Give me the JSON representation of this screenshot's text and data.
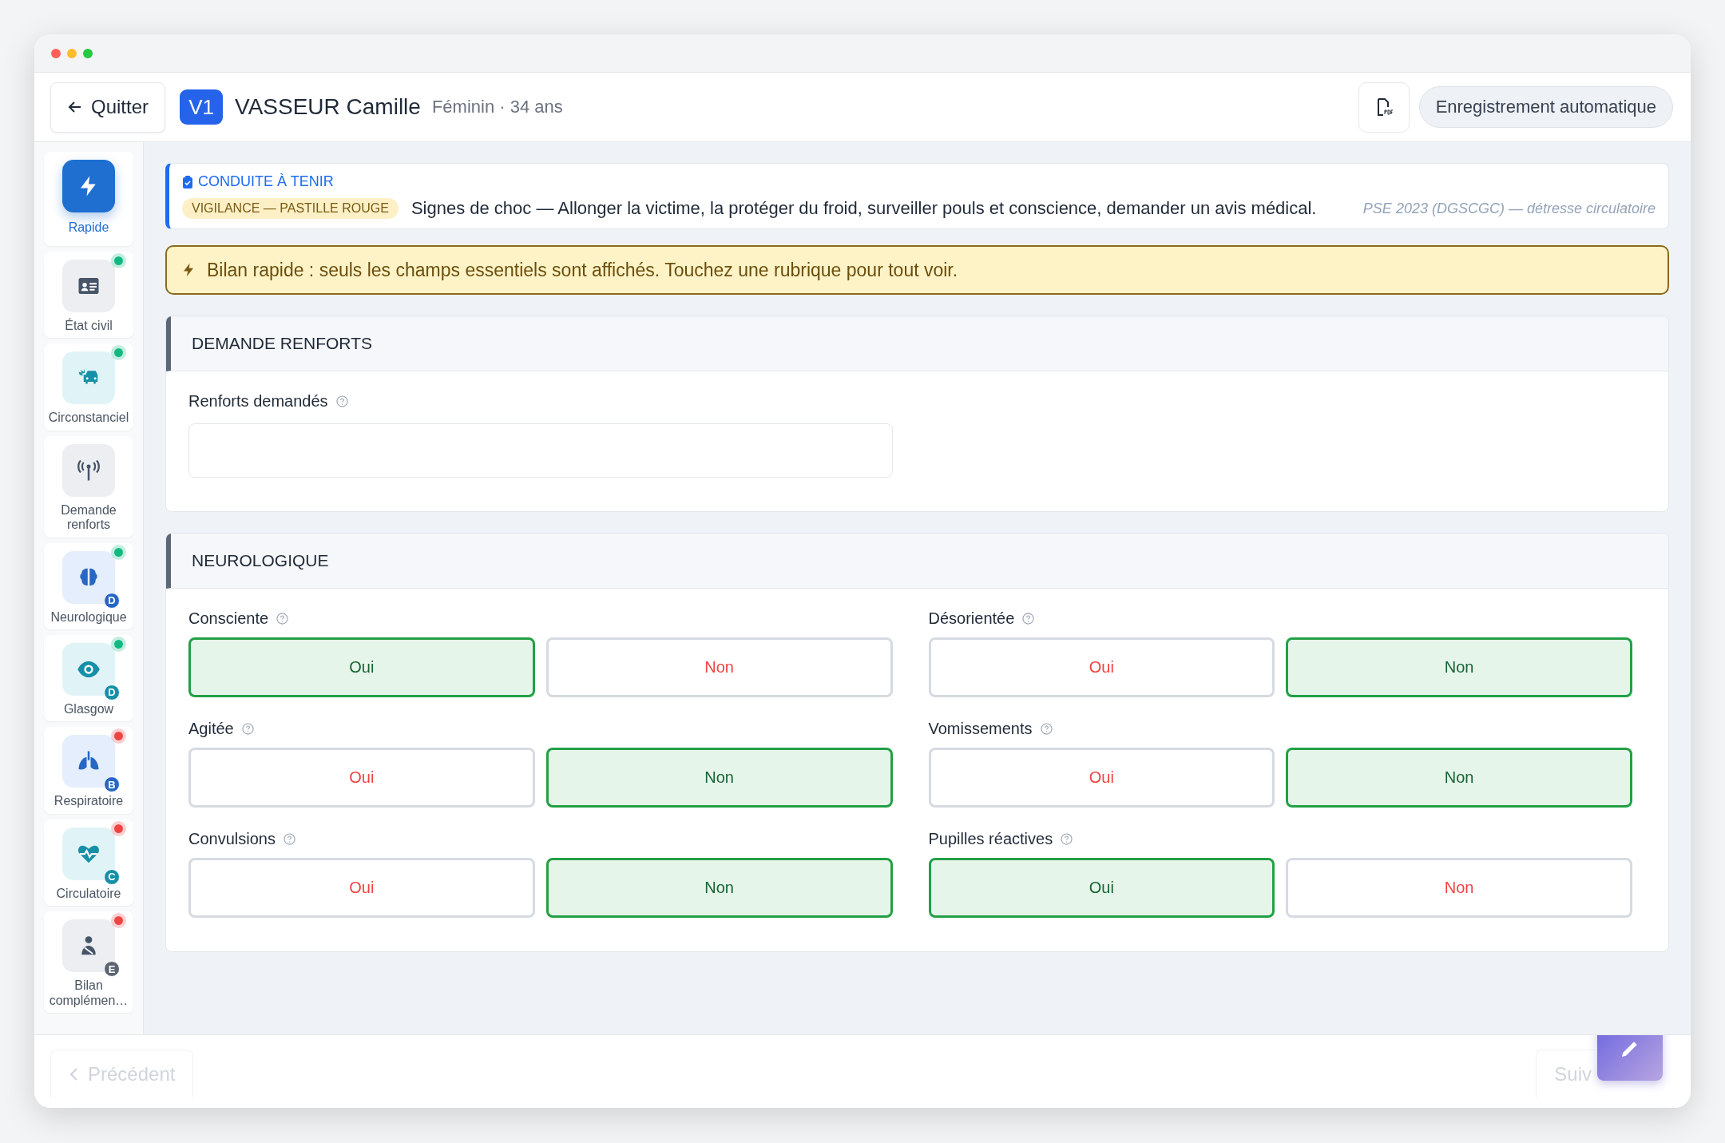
{
  "header": {
    "back_button": "Quitter",
    "victim_badge": "V1",
    "patient_name": "VASSEUR Camille",
    "patient_info": "Féminin · 34 ans",
    "autosave": "Enregistrement automatique"
  },
  "sidebar": {
    "items": [
      {
        "label": "Rapide",
        "selected": true
      },
      {
        "label": "État civil",
        "selected": false,
        "color": "#10b981"
      },
      {
        "label": "Circonstanciel",
        "selected": false,
        "color": "#10b981"
      },
      {
        "label": "Demande renforts",
        "selected": false
      },
      {
        "label": "Neurologique",
        "selected": false,
        "color": "#10b981",
        "badge": "D"
      },
      {
        "label": "Glasgow",
        "selected": false,
        "color": "#10b981",
        "badge": "D"
      },
      {
        "label": "Respiratoire",
        "selected": false,
        "color": "#ef4444",
        "badge": "B"
      },
      {
        "label": "Circulatoire",
        "selected": false,
        "color": "#ef4444",
        "badge": "C"
      },
      {
        "label": "Bilan complémen…",
        "selected": false,
        "color": "#ef4444",
        "badge": "E"
      }
    ]
  },
  "conduct": {
    "title": "CONDUITE À TENIR",
    "tag": "VIGILANCE — PASTILLE ROUGE",
    "text": "Signes de choc — Allonger la victime, la protéger du froid, surveiller pouls et conscience, demander un avis médical.",
    "source": "PSE 2023 (DGSCGC) — détresse circulatoire"
  },
  "notice": "Bilan rapide : seuls les champs essentiels sont affichés. Touchez une rubrique pour tout voir.",
  "sections": [
    {
      "title": "DEMANDE RENFORTS",
      "fields": [
        {
          "kind": "text",
          "label": "Renforts demandés"
        }
      ]
    },
    {
      "title": "NEUROLOGIQUE",
      "fields": [
        {
          "kind": "yesno",
          "label": "Consciente",
          "options": [
            {
              "label": "Oui",
              "selected": true
            },
            {
              "label": "Non",
              "selected": false
            }
          ]
        },
        {
          "kind": "yesno",
          "label": "Désorientée",
          "options": [
            {
              "label": "Oui",
              "selected": false
            },
            {
              "label": "Non",
              "selected": true
            }
          ]
        },
        {
          "kind": "yesno",
          "label": "Agitée",
          "options": [
            {
              "label": "Oui",
              "selected": false
            },
            {
              "label": "Non",
              "selected": true
            }
          ]
        },
        {
          "kind": "yesno",
          "label": "Vomissements",
          "options": [
            {
              "label": "Oui",
              "selected": false
            },
            {
              "label": "Non",
              "selected": true
            }
          ]
        },
        {
          "kind": "yesno",
          "label": "Convulsions",
          "options": [
            {
              "label": "Oui",
              "selected": false
            },
            {
              "label": "Non",
              "selected": true
            }
          ]
        },
        {
          "kind": "yesno",
          "label": "Pupilles réactives",
          "options": [
            {
              "label": "Oui",
              "selected": true
            },
            {
              "label": "Non",
              "selected": false
            }
          ]
        }
      ]
    }
  ],
  "footer": {
    "previous": "Précédent",
    "next": "Suiv"
  }
}
